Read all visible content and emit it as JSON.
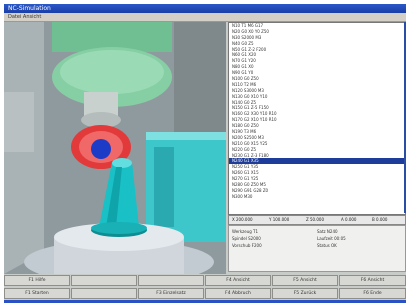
{
  "window": {
    "title": "NC-Simulation"
  },
  "menubar": {
    "text": "Datei Ansicht"
  },
  "program_list": {
    "rows": [
      "N10 T1 M6 G17",
      "N20 G0 X0 Y0 Z50",
      "N30 S2000 M3",
      "N40 G0 Z5",
      "N50 G1 Z-2 F200",
      "N60 G1 X20",
      "N70 G1 Y20",
      "N80 G1 X0",
      "N90 G1 Y0",
      "N100 G0 Z50",
      "N110 T2 M6",
      "N120 S3000 M3",
      "N130 G0 X10 Y10",
      "N140 G0 Z5",
      "N150 G1 Z-5 F150",
      "N160 G2 X30 Y10 R10",
      "N170 G2 X10 Y10 R10",
      "N180 G0 Z50",
      "N190 T3 M6",
      "N200 S2500 M3",
      "N210 G0 X15 Y25",
      "N220 G0 Z5",
      "N230 G1 Z-3 F180",
      "N240 G1 X35",
      "N250 G1 Y35",
      "N260 G1 X15",
      "N270 G1 Y25",
      "N280 G0 Z50 M5",
      "N290 G91 G28 Z0",
      "N300 M30",
      "",
      ""
    ],
    "selected_index": 23
  },
  "coords": {
    "x": "X 200.000",
    "y": "Y 100.000",
    "z": "Z 50.000",
    "a": "A 0.000",
    "b": "B 0.000"
  },
  "info": {
    "left": [
      "Werkzeug T1",
      "Spindel S2000",
      "Vorschub F200"
    ],
    "right": [
      "Satz N240",
      "Laufzeit 00:05",
      "Status OK"
    ]
  },
  "buttons_row1": [
    "F1 Hilfe",
    "",
    "",
    "F4 Ansicht",
    "F5 Ansicht",
    "F6 Ansicht"
  ],
  "buttons_row2": [
    "F1 Starten",
    "",
    "F3 Einzelsatz",
    "F4 Abbruch",
    "F5 Zurück",
    "F6 Ende"
  ],
  "colors": {
    "tool_holder": "#86cfa4",
    "toolhead_red": "#e23a3a",
    "toolhead_blue": "#1c3cc8",
    "workpiece_cyan": "#19c0c6",
    "block_cyan": "#3ec7cb",
    "base_grey": "#d0d6dc",
    "list_selection": "#1e3c9a"
  }
}
